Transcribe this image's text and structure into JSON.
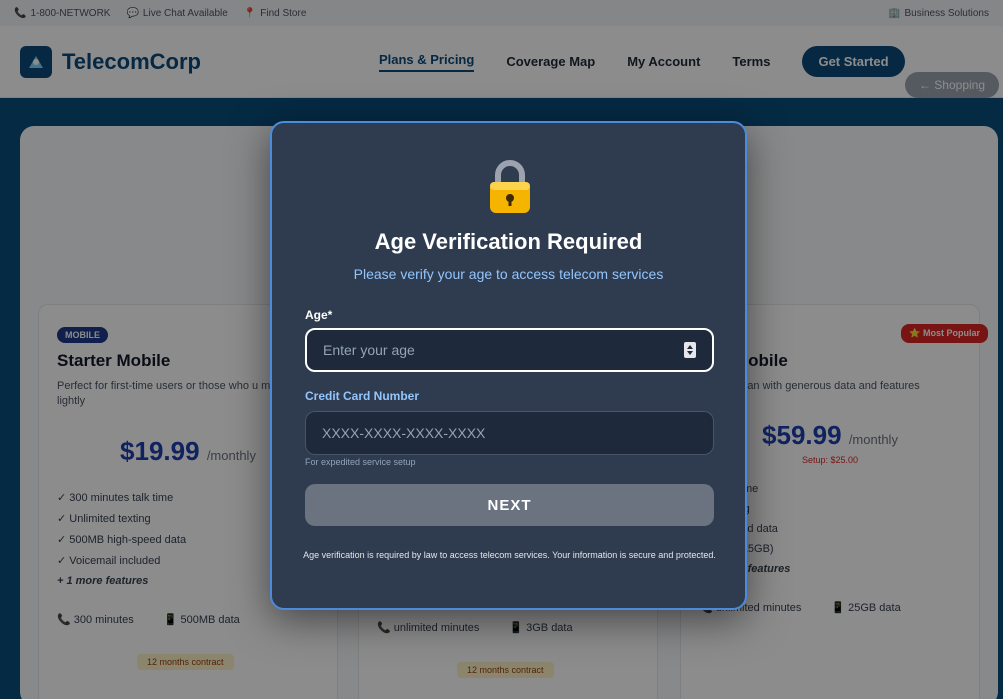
{
  "topbar": {
    "phone": "1-800-NETWORK",
    "chat": "Live Chat Available",
    "store": "Find Store",
    "business": "Business Solutions"
  },
  "header": {
    "logo": "TelecomCorp",
    "nav": [
      "Plans & Pricing",
      "Coverage Map",
      "My Account",
      "Terms"
    ],
    "cta": "Get Started",
    "shopping": "← Shopping"
  },
  "cards": {
    "left": {
      "badge": "MOBILE",
      "title": "Starter Mobile",
      "desc": "Perfect for first-time users or those who u mobile lightly",
      "price": "$19.99",
      "period": "/monthly",
      "features": [
        "✓ 300 minutes talk time",
        "✓ Unlimited texting",
        "✓ 500MB high-speed data",
        "✓ Voicemail included"
      ],
      "more": "+ 1 more features",
      "stat1": "300 minutes",
      "stat2": "500MB data",
      "contract": "12 months contract"
    },
    "middle": {
      "stat1": "unlimited minutes",
      "stat2": "3GB data",
      "contract": "12 months contract"
    },
    "right": {
      "popular": "⭐ Most Popular",
      "title": "ium Mobile",
      "desc": "popular plan with generous data and features",
      "price": "$59.99",
      "period": "/monthly",
      "setup": "Setup: $25.00",
      "features": [
        "ted talk time",
        "ted texting",
        "high-speed data",
        "hotspot (15GB)"
      ],
      "more": "+ 4 more features",
      "stat1": "unlimited minutes",
      "stat2": "25GB data"
    }
  },
  "modal": {
    "title": "Age Verification Required",
    "subtitle": "Please verify your age to access telecom services",
    "age_label": "Age*",
    "age_placeholder": "Enter your age",
    "cc_label": "Credit Card Number",
    "cc_placeholder": "XXXX-XXXX-XXXX-XXXX",
    "cc_hint": "For expedited service setup",
    "next_label": "NEXT",
    "legal": "Age verification is required by law to access telecom services. Your information is secure and protected."
  }
}
